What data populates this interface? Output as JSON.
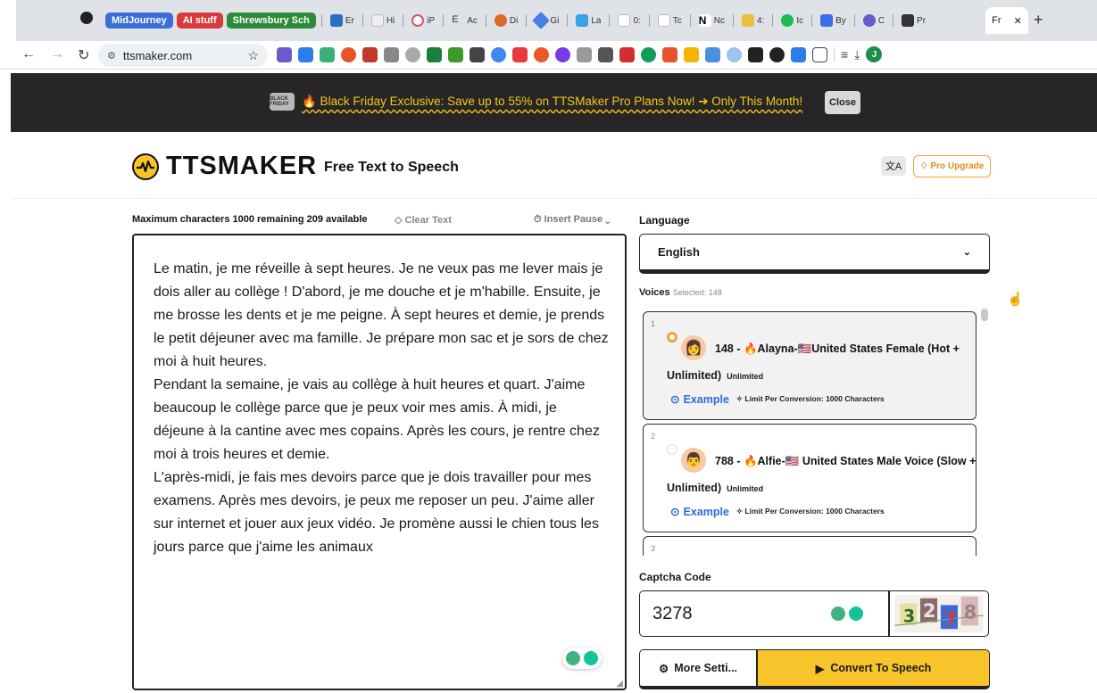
{
  "browser": {
    "bookmarks": [
      {
        "label": "MidJourney",
        "color": "#3b6fd6"
      },
      {
        "label": "AI stuff",
        "color": "#d93a3a"
      },
      {
        "label": "Shrewsbury Sch",
        "color": "#2e8b3a"
      }
    ],
    "tabs": [
      "Er",
      "Hi",
      "iP",
      "Ac",
      "Di",
      "Gi",
      "La",
      "0:",
      "Tc",
      "Nc",
      "4:",
      "Ic",
      "By",
      "C",
      "Pr"
    ],
    "active_tab": "Fr",
    "url": "ttsmaker.com"
  },
  "banner": {
    "text": "🔥 Black Friday Exclusive: Save up to 55% on TTSMaker Pro Plans Now! ➔ Only This Month!",
    "badge": "BLACK FRIDAY",
    "close_label": "Close"
  },
  "header": {
    "logo": "TTSMAKER",
    "tagline": "Free Text to Speech",
    "pro_label": "Pro Upgrade"
  },
  "editor": {
    "max_chars": "Maximum characters 1000 remaining 209 available",
    "clear_label": "Clear Text",
    "insert_pause": "Insert Pause",
    "paragraphs": [
      "Le matin, je me réveille à sept heures. Je ne veux pas me lever mais je dois aller au collège ! D'abord, je me douche et je m'habille. Ensuite, je me brosse les dents et je me peigne. À sept heures et demie, je prends le petit déjeuner avec ma famille. Je prépare mon sac et je sors de chez moi à huit heures.",
      "Pendant la semaine, je vais au collège à huit heures et quart. J'aime beaucoup le collège parce que je peux voir mes amis. À midi, je déjeune à la cantine avec mes copains. Après les cours, je rentre chez moi à trois heures et demie.",
      "L'après-midi, je fais mes devoirs parce que je dois travailler pour mes examens. Après mes devoirs, je peux me reposer un peu. J'aime aller sur internet et jouer aux jeux vidéo. Je promène aussi le chien tous les jours parce que j'aime les animaux"
    ]
  },
  "language": {
    "label": "Language",
    "value": "English"
  },
  "voices": {
    "label": "Voices",
    "selected": "Selected: 148",
    "items": [
      {
        "index": "1",
        "name": "148 - 🔥Alayna-🇺🇸United States Female (Hot +",
        "line2": "Unlimited)",
        "tag": "Unlimited",
        "example": "Example",
        "limit": "Limit Per Conversion: 1000 Characters",
        "avatar": "👩"
      },
      {
        "index": "2",
        "name": "788 - 🔥Alfie-🇺🇸 United States Male Voice (Slow +",
        "line2": "Unlimited)",
        "tag": "Unlimited",
        "example": "Example",
        "limit": "Limit Per Conversion: 1000 Characters",
        "avatar": "👨"
      },
      {
        "index": "3"
      }
    ]
  },
  "captcha": {
    "label": "Captcha Code",
    "value": "3278",
    "image_text": "3278"
  },
  "actions": {
    "more_settings": "More Setti...",
    "convert": "Convert To Speech"
  }
}
